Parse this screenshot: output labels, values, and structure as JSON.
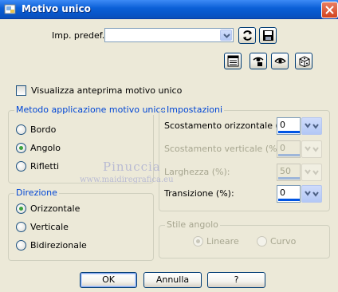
{
  "window": {
    "title": "Motivo unico",
    "close_label": "close"
  },
  "preset": {
    "label": "Imp. predef.:",
    "value": ""
  },
  "preview": {
    "label": "Visualizza anteprima motivo unico",
    "checked": false
  },
  "method_group": {
    "title": "Metodo applicazione motivo unico",
    "options": [
      {
        "label": "Bordo",
        "checked": false
      },
      {
        "label": "Angolo",
        "checked": true
      },
      {
        "label": "Rifletti",
        "checked": false
      }
    ]
  },
  "direction_group": {
    "title": "Direzione",
    "options": [
      {
        "label": "Orizzontale",
        "checked": true
      },
      {
        "label": "Verticale",
        "checked": false
      },
      {
        "label": "Bidirezionale",
        "checked": false
      }
    ]
  },
  "settings_group": {
    "title": "Impostazioni",
    "fields": [
      {
        "label": "Scostamento orizzontale (%):",
        "value": "0",
        "enabled": true
      },
      {
        "label": "Scostamento verticale (%):",
        "value": "0",
        "enabled": false
      },
      {
        "label": "Larghezza (%):",
        "value": "50",
        "enabled": false
      },
      {
        "label": "Transizione (%):",
        "value": "0",
        "enabled": true
      }
    ]
  },
  "corner_group": {
    "title": "Stile angolo",
    "options": [
      {
        "label": "Lineare",
        "checked": true,
        "enabled": false
      },
      {
        "label": "Curvo",
        "checked": false,
        "enabled": false
      }
    ]
  },
  "buttons": {
    "ok": "OK",
    "cancel": "Annulla",
    "help": "?"
  },
  "watermark": {
    "line1": "Pinuccia",
    "line2": "www.maidiregrafica.eu"
  },
  "icons": [
    "app-icon",
    "close-icon",
    "chevron-down-icon",
    "reset-icon",
    "save-icon",
    "list-icon",
    "eye-lock-icon",
    "eye-icon",
    "dice-icon"
  ],
  "colors": {
    "titlebar": "#0a5fd6",
    "group_title": "#0046d5",
    "dialog_bg": "#ece9d8",
    "radio_checked": "#3da33d"
  }
}
